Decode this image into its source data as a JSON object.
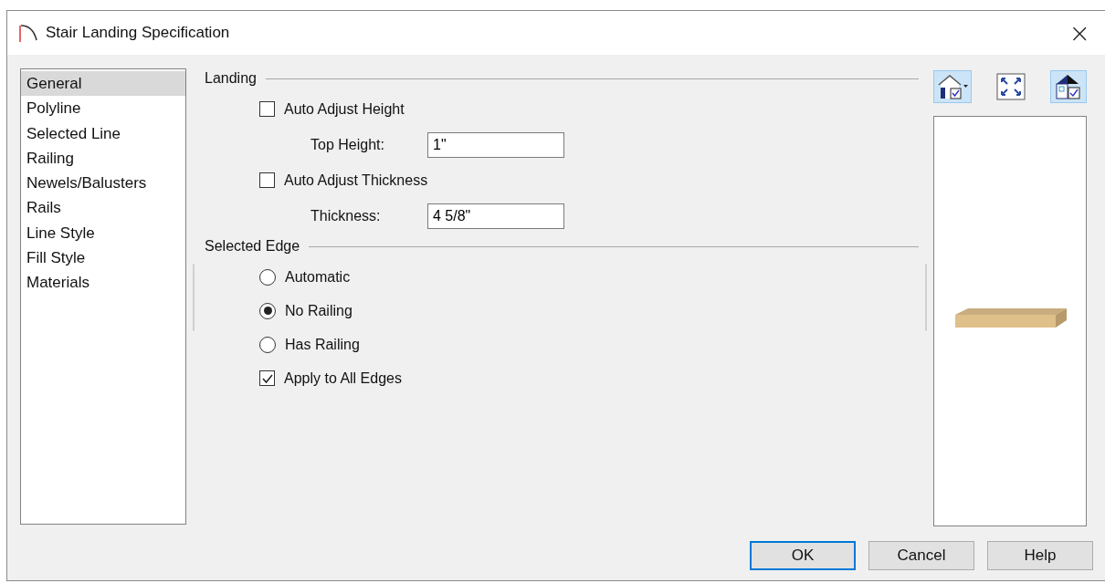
{
  "window": {
    "title": "Stair Landing Specification",
    "close": "×"
  },
  "sidebar": {
    "items": [
      {
        "label": "General",
        "selected": true
      },
      {
        "label": "Polyline",
        "selected": false
      },
      {
        "label": "Selected Line",
        "selected": false
      },
      {
        "label": "Railing",
        "selected": false
      },
      {
        "label": "Newels/Balusters",
        "selected": false
      },
      {
        "label": "Rails",
        "selected": false
      },
      {
        "label": "Line Style",
        "selected": false
      },
      {
        "label": "Fill Style",
        "selected": false
      },
      {
        "label": "Materials",
        "selected": false
      }
    ]
  },
  "sections": [
    {
      "title": "Landing",
      "rows": [
        {
          "kind": "checkbox",
          "label": "Auto Adjust Height",
          "checked": false
        },
        {
          "kind": "field",
          "label": "Top Height:",
          "value": "1\""
        },
        {
          "kind": "checkbox",
          "label": "Auto Adjust Thickness",
          "checked": false
        },
        {
          "kind": "field",
          "label": "Thickness:",
          "value": "4 5/8\""
        }
      ]
    },
    {
      "title": "Selected Edge",
      "rows": [
        {
          "kind": "radio",
          "label": "Automatic",
          "selected": false
        },
        {
          "kind": "radio",
          "label": "No Railing",
          "selected": true
        },
        {
          "kind": "radio",
          "label": "Has Railing",
          "selected": false
        },
        {
          "kind": "checkbox",
          "label": "Apply to All Edges",
          "checked": true
        }
      ]
    }
  ],
  "preview_toolbar": [
    {
      "kind": "camera",
      "selected": true
    },
    {
      "kind": "fit",
      "selected": false
    },
    {
      "kind": "layers",
      "selected": true
    }
  ],
  "buttons": [
    {
      "label": "OK",
      "default": true
    },
    {
      "label": "Cancel",
      "default": false
    },
    {
      "label": "Help",
      "default": false
    }
  ]
}
